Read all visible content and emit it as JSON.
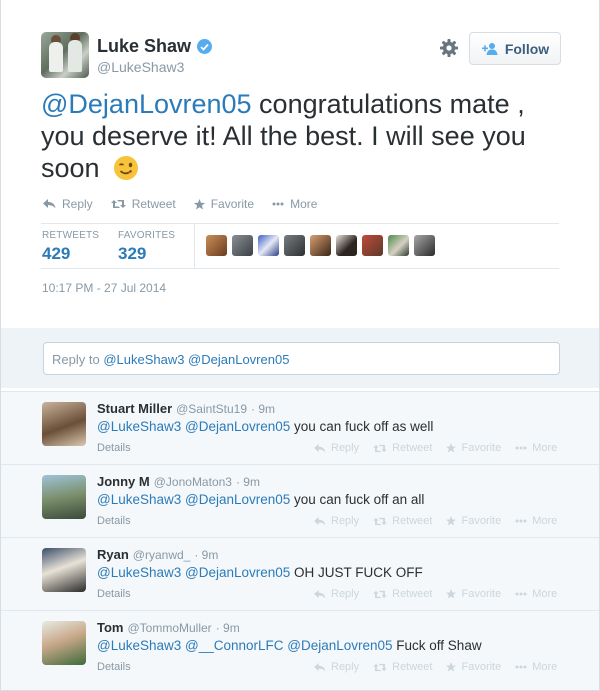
{
  "author": {
    "name": "Luke Shaw",
    "handle": "@LukeShaw3"
  },
  "follow_label": "Follow",
  "tweet": {
    "mention": "@DejanLovren05",
    "text_rest": " congratulations mate , you deserve it! All the best. I will see you soon",
    "emoji": "winking-face"
  },
  "actions": {
    "reply": "Reply",
    "retweet": "Retweet",
    "favorite": "Favorite",
    "more": "More"
  },
  "stats": {
    "retweets_label": "RETWEETS",
    "retweets_value": "429",
    "favorites_label": "FAVORITES",
    "favorites_value": "329"
  },
  "timestamp": "10:17 PM - 27 Jul 2014",
  "reply_box": {
    "prefix": "Reply to ",
    "mentions": "@LukeShaw3 @DejanLovren05"
  },
  "replies": [
    {
      "name": "Stuart Miller",
      "handle": "@SaintStu19",
      "time": "· 9m",
      "mentions": "@LukeShaw3 @DejanLovren05",
      "text": " you can fuck off as well",
      "details": "Details"
    },
    {
      "name": "Jonny M",
      "handle": "@JonoMaton3",
      "time": "· 9m",
      "mentions": "@LukeShaw3 @DejanLovren05",
      "text": " you can fuck off an all",
      "details": "Details"
    },
    {
      "name": "Ryan",
      "handle": "@ryanwd_",
      "time": "· 9m",
      "mentions": "@LukeShaw3 @DejanLovren05",
      "text": " OH JUST FUCK OFF",
      "details": "Details"
    },
    {
      "name": "Tom",
      "handle": "@TommoMuller",
      "time": "· 9m",
      "mentions": "@LukeShaw3 @__ConnorLFC @DejanLovren05",
      "text": " Fuck off Shaw",
      "details": "Details"
    }
  ],
  "colors": {
    "link": "#2b7bb9",
    "muted": "#8899a6",
    "verified": "#55acee",
    "reply_bg": "#f5f8fa"
  }
}
